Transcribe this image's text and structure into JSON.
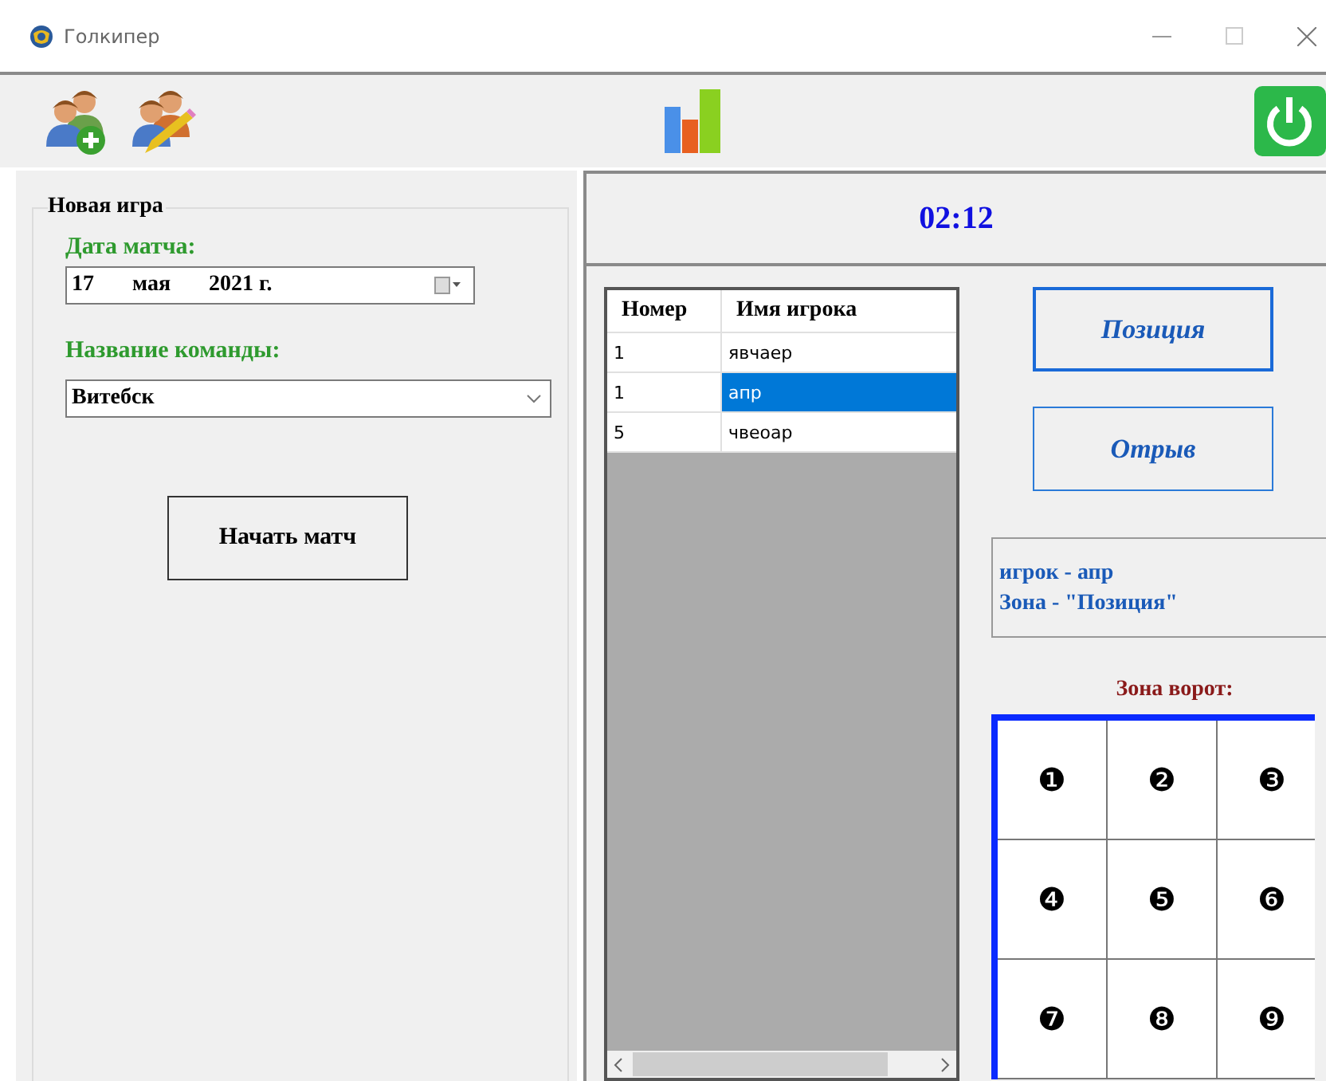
{
  "window": {
    "title": "Голкипер"
  },
  "new_game": {
    "title": "Новая игра",
    "date_label": "Дата матча:",
    "date": {
      "day": "17",
      "month": "мая",
      "year": "2021 г."
    },
    "team_label": "Название команды:",
    "team": "Витебск",
    "start_button": "Начать матч"
  },
  "timer": "02:12",
  "players": {
    "columns": [
      "Номер",
      "Имя игрока"
    ],
    "rows": [
      {
        "number": "1",
        "name": "явчаер",
        "selected": false
      },
      {
        "number": "1",
        "name": "апр",
        "selected": true
      },
      {
        "number": "5",
        "name": "чвеоар",
        "selected": false
      }
    ]
  },
  "actions": [
    {
      "label": "Позиция",
      "selected": true
    },
    {
      "label": "Отрыв",
      "selected": false
    }
  ],
  "info": {
    "lines": [
      "игрок - апр",
      "Зона - \"Позиция\""
    ]
  },
  "goal_zone": {
    "title": "Зона ворот:",
    "cells": [
      "❶",
      "❷",
      "❸",
      "❹",
      "❺",
      "❻",
      "❼",
      "❽",
      "❾"
    ]
  }
}
